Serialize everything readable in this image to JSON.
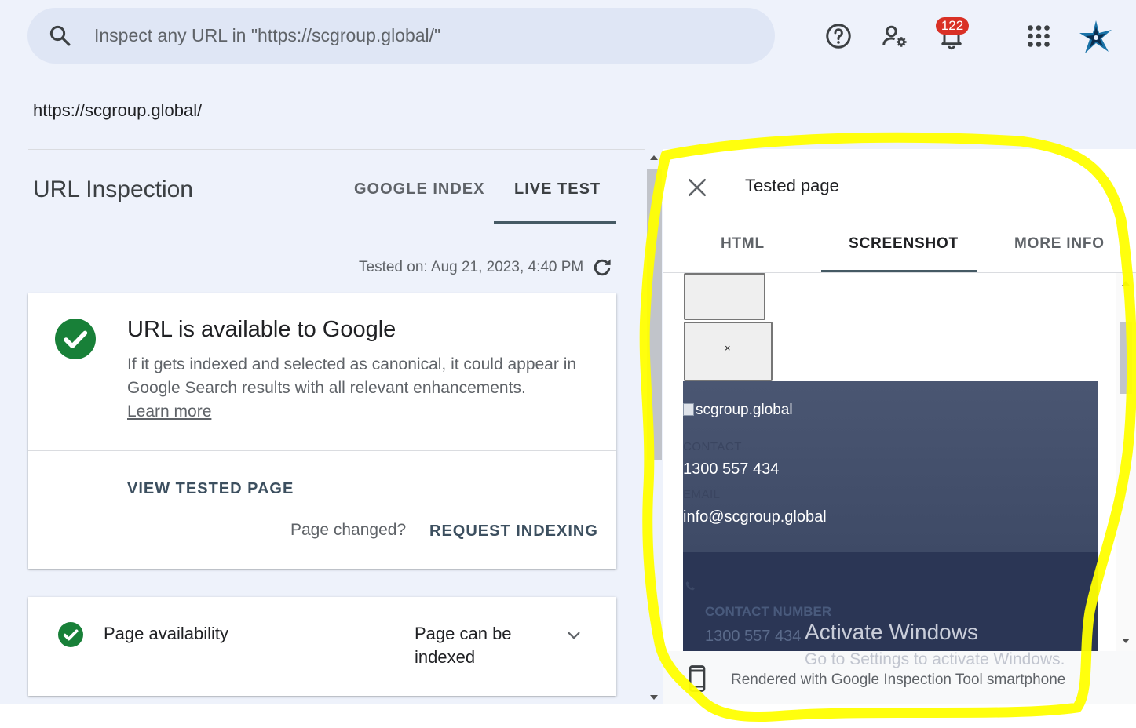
{
  "search": {
    "placeholder": "Inspect any URL in \"https://scgroup.global/\""
  },
  "header_icons": {
    "help": "help-icon",
    "admin": "manage-users-icon",
    "notifications": "bell-icon",
    "apps": "apps-grid-icon",
    "account": "account-avatar"
  },
  "notifications": {
    "count": "122"
  },
  "colors": {
    "accent": "#455a64",
    "success": "#188038",
    "badge": "#d93025",
    "highlight": "#ffff00"
  },
  "page_url": "https://scgroup.global/",
  "left": {
    "title": "URL Inspection",
    "tabs": [
      "GOOGLE INDEX",
      "LIVE TEST"
    ],
    "active_tab": "LIVE TEST",
    "tested_on": "Tested on: Aug 21, 2023, 4:40 PM",
    "status_card": {
      "title": "URL is available to Google",
      "description": "If it gets indexed and selected as canonical, it could appear in Google Search results with all relevant enhancements.",
      "learn_more": "Learn more",
      "view_tested_page": "VIEW TESTED PAGE",
      "page_changed": "Page changed?",
      "request_indexing": "REQUEST INDEXING"
    },
    "availability": {
      "label": "Page availability",
      "value": "Page can be indexed"
    }
  },
  "right": {
    "title": "Tested page",
    "tabs": [
      "HTML",
      "SCREENSHOT",
      "MORE INFO"
    ],
    "active_tab": "SCREENSHOT",
    "screenshot": {
      "placeholder_symbol": "×",
      "logo_alt": "scgroup.global",
      "contact_label": "CONTACT",
      "phone": "1300 557 434",
      "email_label": "EMAIL",
      "email": "info@scgroup.global",
      "contact_number_label": "CONTACT NUMBER",
      "contact_number": "1300 557 434"
    },
    "rendered_with": "Rendered with Google Inspection Tool smartphone"
  },
  "watermark": {
    "line1": "Activate Windows",
    "line2": "Go to Settings to activate Windows."
  }
}
